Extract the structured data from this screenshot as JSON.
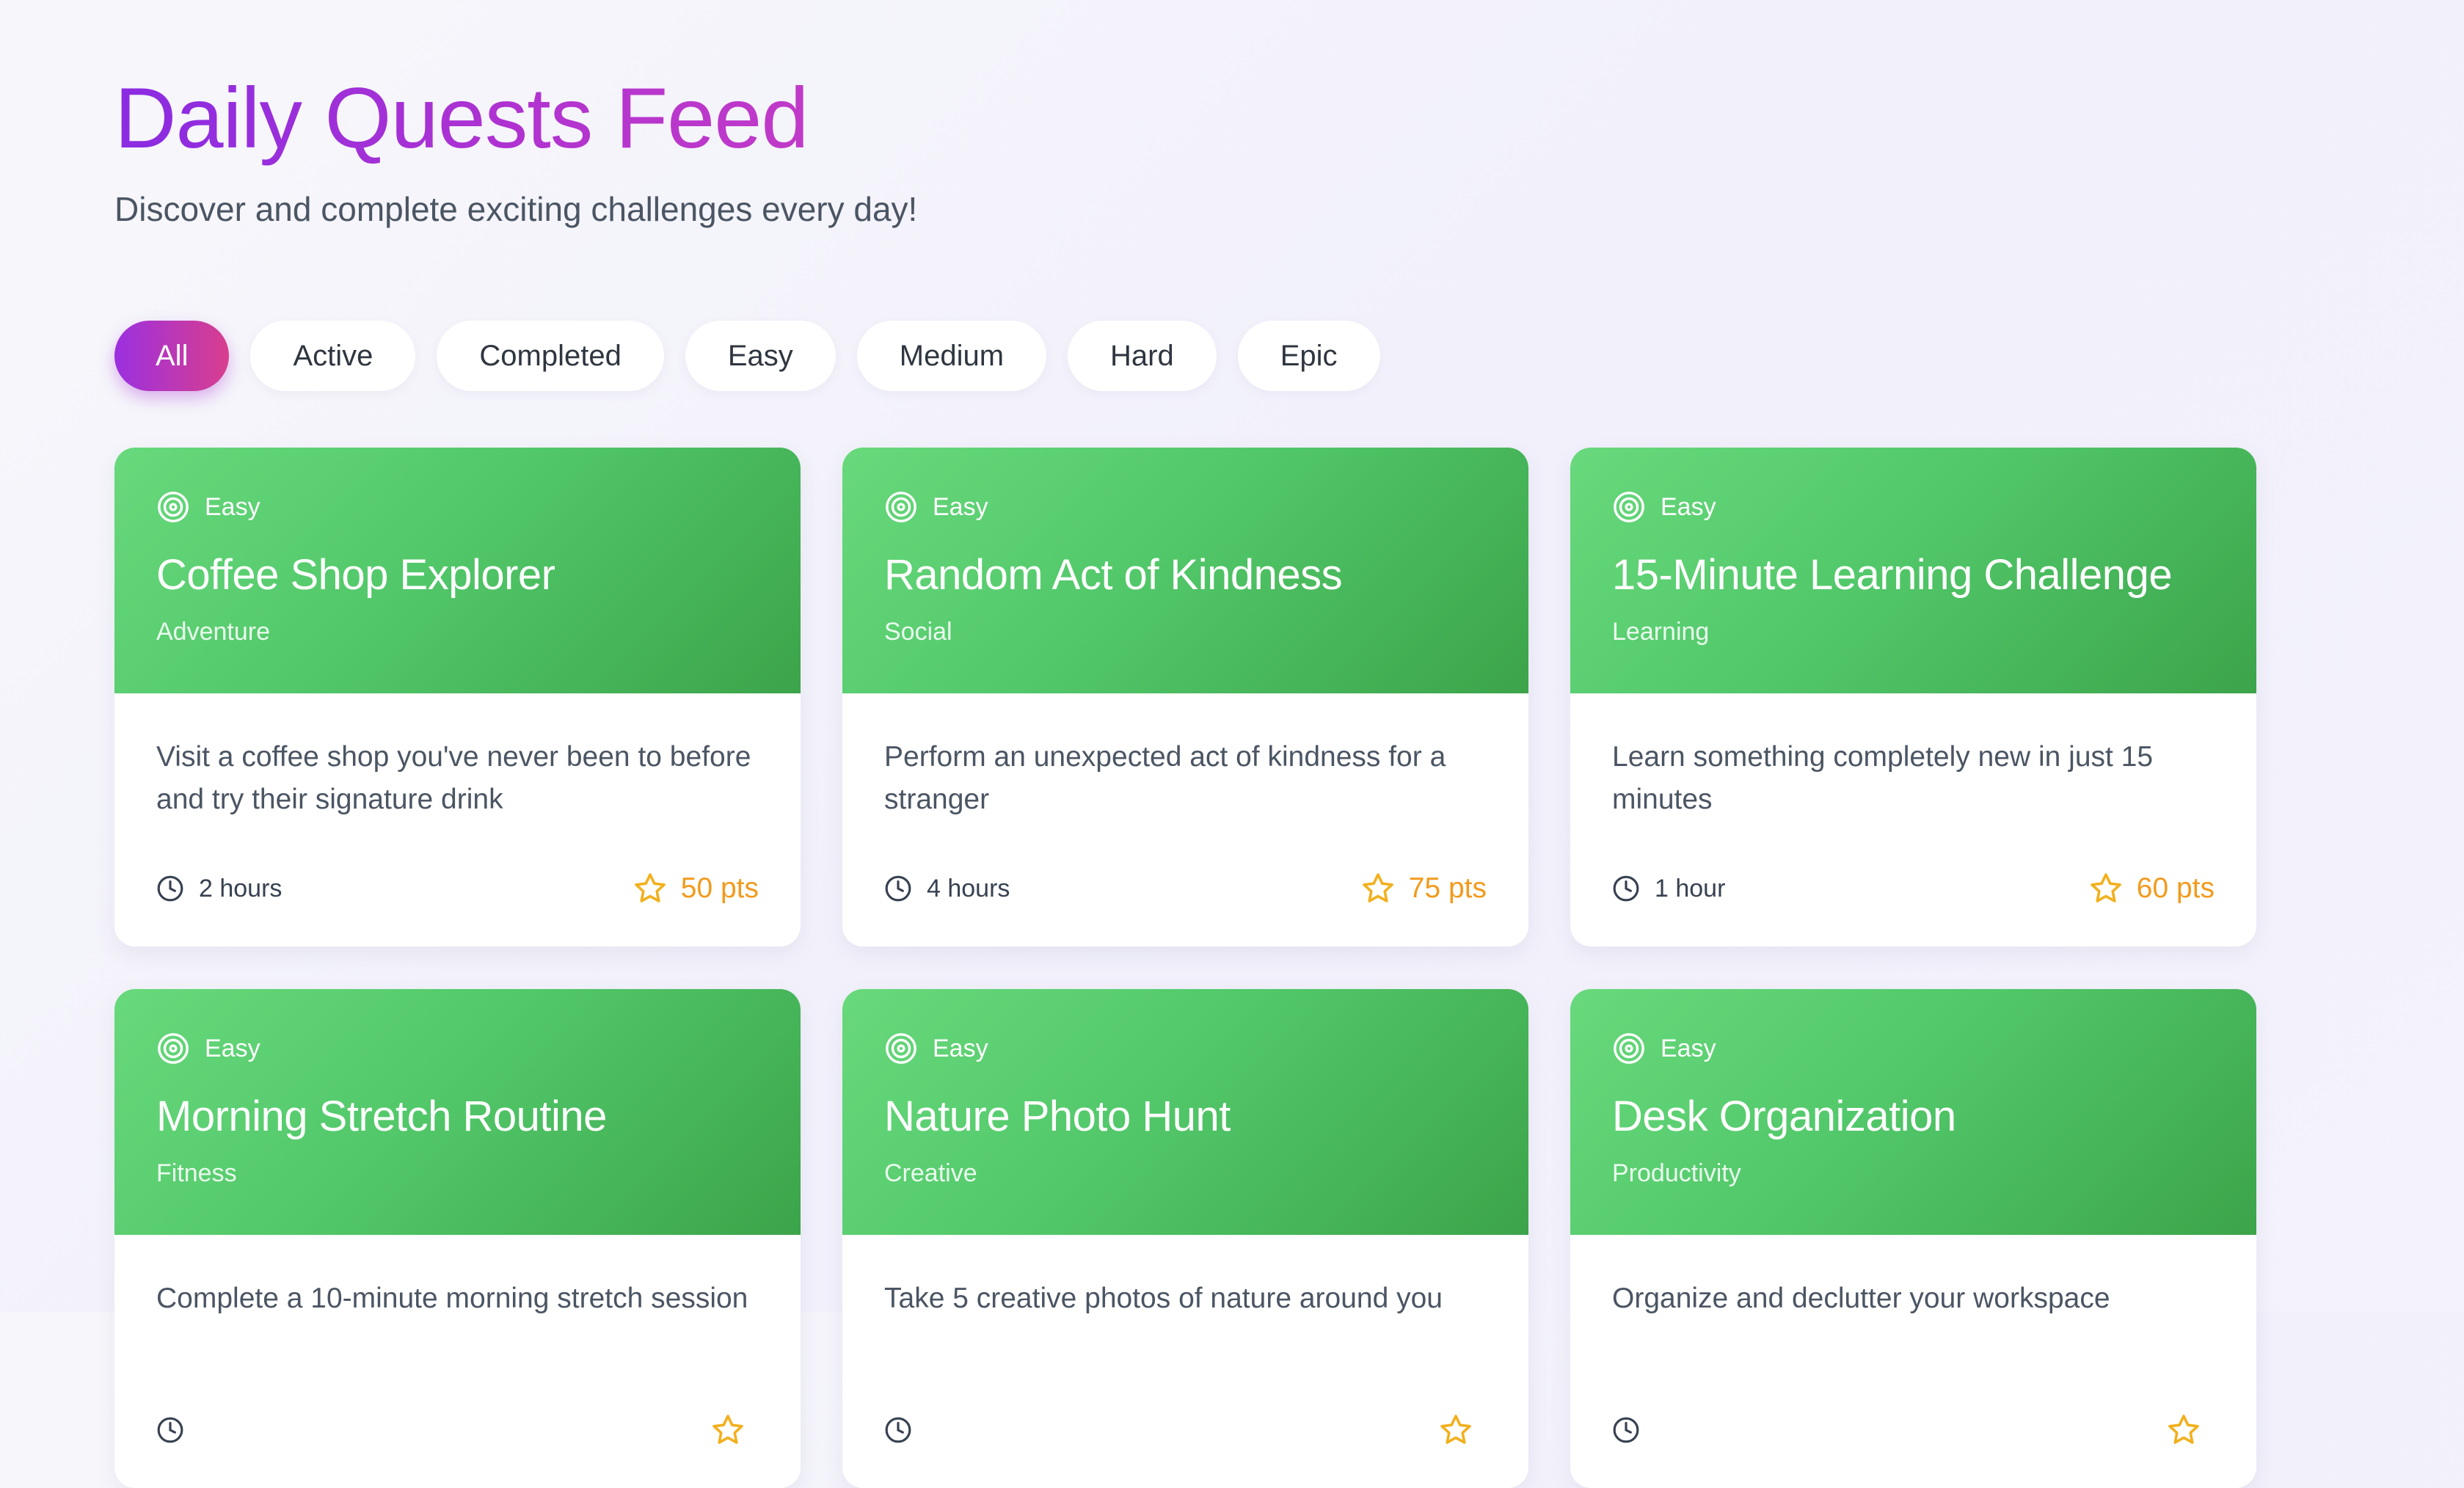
{
  "header": {
    "title": "Daily Quests Feed",
    "subtitle": "Discover and complete exciting challenges every day!"
  },
  "filters": [
    {
      "label": "All",
      "active": true
    },
    {
      "label": "Active",
      "active": false
    },
    {
      "label": "Completed",
      "active": false
    },
    {
      "label": "Easy",
      "active": false
    },
    {
      "label": "Medium",
      "active": false
    },
    {
      "label": "Hard",
      "active": false
    },
    {
      "label": "Epic",
      "active": false
    }
  ],
  "quests": [
    {
      "difficulty": "Easy",
      "title": "Coffee Shop Explorer",
      "category": "Adventure",
      "description": "Visit a coffee shop you've never been to before and try their signature drink",
      "duration": "2 hours",
      "points": "50 pts"
    },
    {
      "difficulty": "Easy",
      "title": "Random Act of Kindness",
      "category": "Social",
      "description": "Perform an unexpected act of kindness for a stranger",
      "duration": "4 hours",
      "points": "75 pts"
    },
    {
      "difficulty": "Easy",
      "title": "15-Minute Learning Challenge",
      "category": "Learning",
      "description": "Learn something completely new in just 15 minutes",
      "duration": "1 hour",
      "points": "60 pts"
    },
    {
      "difficulty": "Easy",
      "title": "Morning Stretch Routine",
      "category": "Fitness",
      "description": "Complete a 10-minute morning stretch session",
      "duration": "",
      "points": ""
    },
    {
      "difficulty": "Easy",
      "title": "Nature Photo Hunt",
      "category": "Creative",
      "description": "Take 5 creative photos of nature around you",
      "duration": "",
      "points": ""
    },
    {
      "difficulty": "Easy",
      "title": "Desk Organization",
      "category": "Productivity",
      "description": "Organize and declutter your workspace",
      "duration": "",
      "points": ""
    }
  ],
  "icons": {
    "difficulty": "target-icon",
    "duration": "clock-icon",
    "points": "star-icon"
  },
  "colors": {
    "accent_start": "#9b30e0",
    "accent_end": "#d93e8e",
    "easy_header": "#52c86a",
    "points": "#f29a1e"
  }
}
